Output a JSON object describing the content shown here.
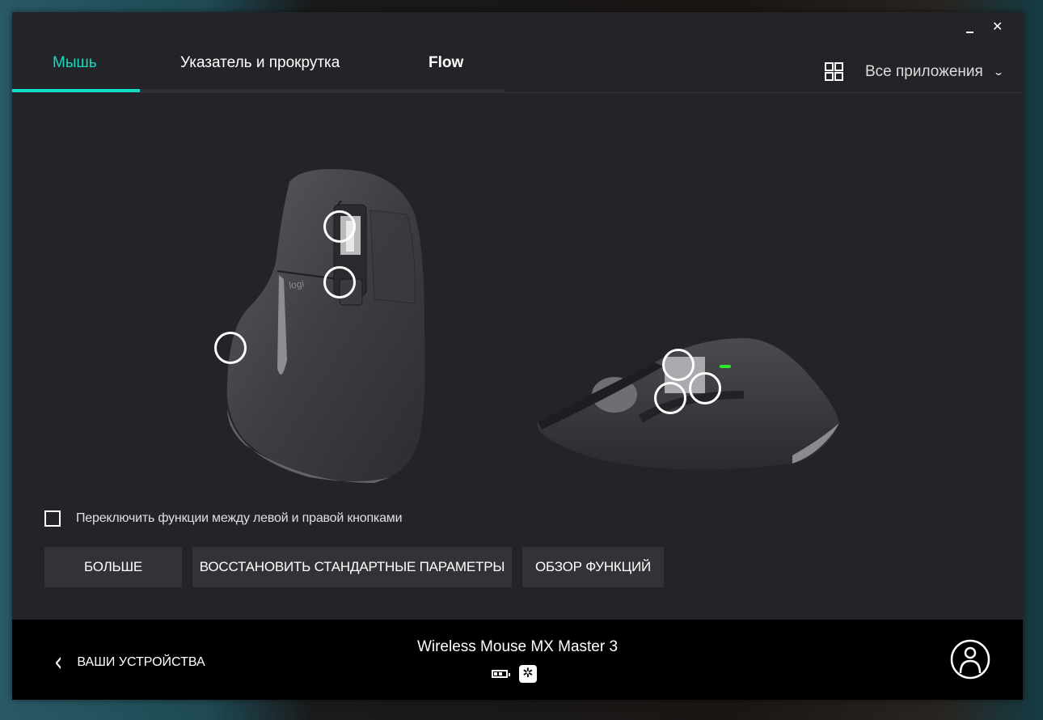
{
  "window": {
    "minimize_label": "_",
    "close_label": "✕"
  },
  "tabs": [
    {
      "label": "Мышь",
      "active": true
    },
    {
      "label": "Указатель и прокрутка",
      "active": false
    },
    {
      "label": "Flow",
      "active": false
    }
  ],
  "app_selector": {
    "icon": "grid-icon",
    "label": "Все приложения",
    "chevron": "⌄"
  },
  "mouse_views": {
    "top_view": {
      "name": "MX Master 3 top view",
      "logo_text": "logi",
      "hotspots": [
        "scroll-wheel",
        "mode-shift-button",
        "gesture-button"
      ]
    },
    "side_view": {
      "name": "MX Master 3 side view",
      "hotspots": [
        "thumb-wheel",
        "back-button",
        "forward-button"
      ],
      "status_led_color": "#2ee82e"
    }
  },
  "checkbox": {
    "label": "Переключить функции между левой и правой кнопками",
    "checked": false
  },
  "buttons": {
    "more": "БОЛЬШЕ",
    "restore_defaults": "ВОССТАНОВИТЬ СТАНДАРТНЫЕ ПАРАМЕТРЫ",
    "features_tour": "ОБЗОР ФУНКЦИЙ"
  },
  "footer": {
    "back_label": "ВАШИ УСТРОЙСТВА",
    "back_icon": "‹",
    "device_name": "Wireless Mouse MX Master 3",
    "battery_level": "2 of 4 bars",
    "connection_icon": "unifying-receiver-icon"
  },
  "colors": {
    "accent": "#12dcc4",
    "window_bg": "#232427",
    "footer_bg": "#000000",
    "button_bg": "#323336"
  }
}
